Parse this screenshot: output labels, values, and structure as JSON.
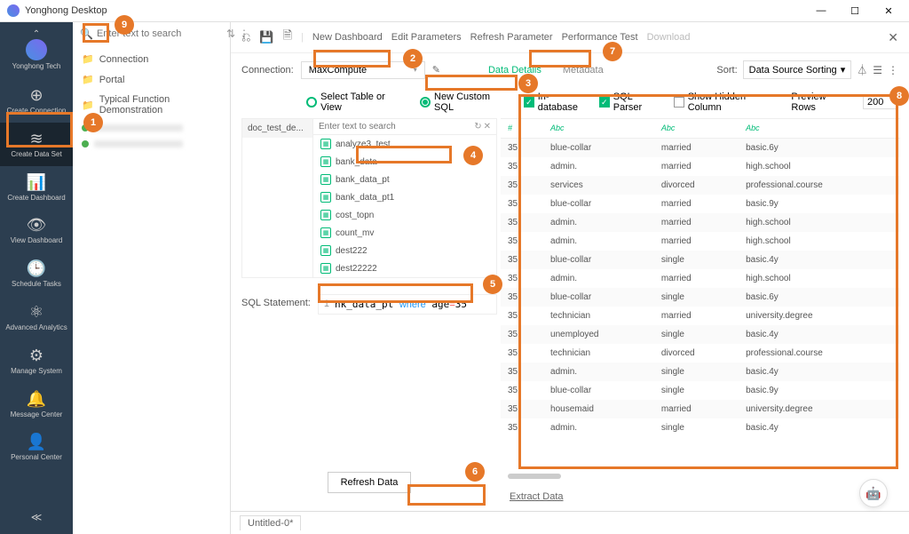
{
  "window": {
    "title": "Yonghong Desktop",
    "min": "—",
    "max": "☐",
    "close": "✕"
  },
  "sidebar": {
    "brand": "Yonghong Tech",
    "items": [
      {
        "icon": "⊕",
        "label": "Create Connection"
      },
      {
        "icon": "≋",
        "label": "Create Data Set"
      },
      {
        "icon": "📊",
        "label": "Create Dashboard"
      },
      {
        "icon": "👁",
        "label": "View Dashboard"
      },
      {
        "icon": "🕒",
        "label": "Schedule Tasks"
      },
      {
        "icon": "⚛",
        "label": "Advanced Analytics"
      },
      {
        "icon": "⚙",
        "label": "Manage System"
      },
      {
        "icon": "🔔",
        "label": "Message Center"
      },
      {
        "icon": "👤",
        "label": "Personal Center"
      }
    ],
    "collapse": "≪"
  },
  "tree": {
    "search_placeholder": "Enter text to search",
    "items": [
      {
        "type": "folder",
        "label": "Connection"
      },
      {
        "type": "folder",
        "label": "Portal"
      },
      {
        "type": "folder",
        "label": "Typical Function Demonstration"
      }
    ]
  },
  "toolbar": {
    "links": [
      "New Dashboard",
      "Edit Parameters",
      "Refresh Parameter",
      "Performance Test",
      "Download"
    ]
  },
  "connection": {
    "label": "Connection:",
    "value": "MaxCompute",
    "tab_details": "Data Details",
    "tab_metadata": "Metadata",
    "sort_label": "Sort:",
    "sort_value": "Data Source Sorting"
  },
  "options": {
    "radio1": "Select Table or View",
    "radio2": "New Custom SQL",
    "chk1": "In-database",
    "chk2": "SQL Parser",
    "chk3": "Show Hidden Column",
    "preview_label": "Preview Rows",
    "preview_value": "200"
  },
  "browser": {
    "db": "doc_test_de...",
    "search_placeholder": "Enter text to search",
    "tables": [
      "analyze3_test",
      "bank_data",
      "bank_data_pt",
      "bank_data_pt1",
      "cost_topn",
      "count_mv",
      "dest222",
      "dest22222"
    ]
  },
  "sql": {
    "label": "SQL Statement:",
    "display": "nk_data_pt where age=35"
  },
  "refresh_label": "Refresh Data",
  "extract_label": "Extract Data",
  "table": {
    "headers": [
      "#",
      "Abc",
      "Abc",
      "Abc"
    ],
    "rows": [
      [
        "35",
        "blue-collar",
        "married",
        "basic.6y"
      ],
      [
        "35",
        "admin.",
        "married",
        "high.school"
      ],
      [
        "35",
        "services",
        "divorced",
        "professional.course"
      ],
      [
        "35",
        "blue-collar",
        "married",
        "basic.9y"
      ],
      [
        "35",
        "admin.",
        "married",
        "high.school"
      ],
      [
        "35",
        "admin.",
        "married",
        "high.school"
      ],
      [
        "35",
        "blue-collar",
        "single",
        "basic.4y"
      ],
      [
        "35",
        "admin.",
        "married",
        "high.school"
      ],
      [
        "35",
        "blue-collar",
        "single",
        "basic.6y"
      ],
      [
        "35",
        "technician",
        "married",
        "university.degree"
      ],
      [
        "35",
        "unemployed",
        "single",
        "basic.4y"
      ],
      [
        "35",
        "technician",
        "divorced",
        "professional.course"
      ],
      [
        "35",
        "admin.",
        "single",
        "basic.4y"
      ],
      [
        "35",
        "blue-collar",
        "single",
        "basic.9y"
      ],
      [
        "35",
        "housemaid",
        "married",
        "university.degree"
      ],
      [
        "35",
        "admin.",
        "single",
        "basic.4y"
      ]
    ]
  },
  "bottom_tab": "Untitled-0*",
  "callouts": {
    "c1": "1",
    "c2": "2",
    "c3": "3",
    "c4": "4",
    "c5": "5",
    "c6": "6",
    "c7": "7",
    "c8": "8",
    "c9": "9"
  }
}
